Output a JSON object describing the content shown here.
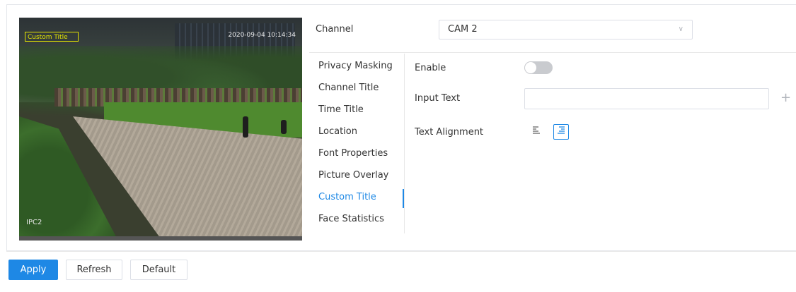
{
  "preview": {
    "overlay_title": "Custom Title",
    "overlay_time": "2020-09-04 10:14:34",
    "overlay_channel": "IPC2"
  },
  "channel": {
    "label": "Channel",
    "value": "CAM 2"
  },
  "menu": {
    "items": [
      {
        "label": "Privacy Masking"
      },
      {
        "label": "Channel Title"
      },
      {
        "label": "Time Title"
      },
      {
        "label": "Location"
      },
      {
        "label": "Font Properties"
      },
      {
        "label": "Picture Overlay"
      },
      {
        "label": "Custom Title",
        "active": true
      },
      {
        "label": "Face Statistics"
      }
    ]
  },
  "form": {
    "enable_label": "Enable",
    "enable_value": false,
    "input_text_label": "Input Text",
    "input_text_value": "",
    "text_alignment_label": "Text Alignment",
    "alignment_selected": "right"
  },
  "icons": {
    "plus": "plus-icon",
    "align_left": "align-left-icon",
    "align_right": "align-right-icon",
    "chevron": "chevron-down-icon"
  },
  "buttons": {
    "apply": "Apply",
    "refresh": "Refresh",
    "default": "Default"
  },
  "colors": {
    "accent": "#1e88e5",
    "overlay": "#e6e600"
  }
}
